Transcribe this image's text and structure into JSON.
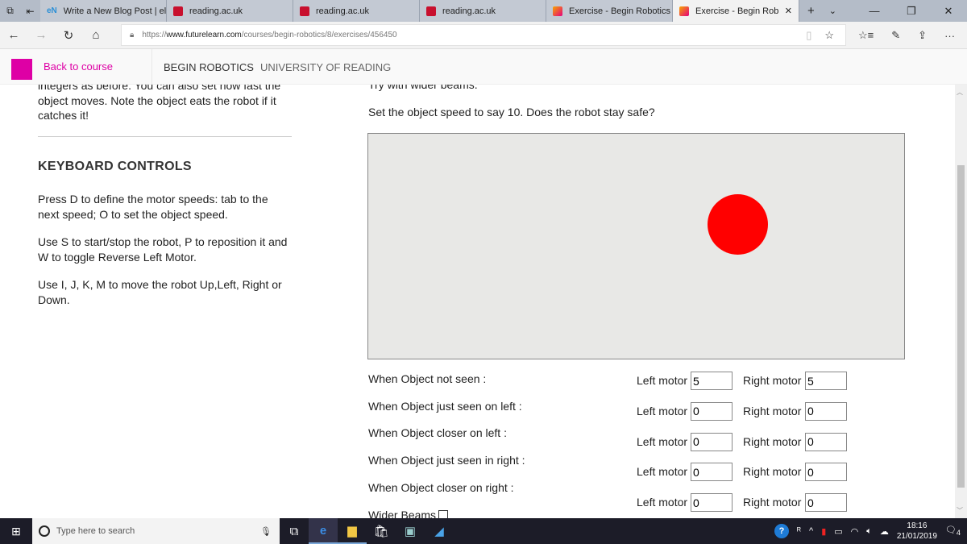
{
  "browser": {
    "tabs": [
      {
        "title": "Write a New Blog Post | eler",
        "icon": "elearning-favicon",
        "icon_text": "eN"
      },
      {
        "title": "reading.ac.uk",
        "icon": "uor-favicon"
      },
      {
        "title": "reading.ac.uk",
        "icon": "uor-favicon"
      },
      {
        "title": "reading.ac.uk",
        "icon": "uor-favicon"
      },
      {
        "title": "Exercise - Begin Robotics - U",
        "icon": "futurelearn-favicon"
      },
      {
        "title": "Exercise - Begin Robotic",
        "icon": "futurelearn-favicon",
        "active": true
      }
    ],
    "url_prefix": "https://",
    "url_domain": "www.futurelearn.com",
    "url_path": "/courses/begin-robotics/8/exercises/456450"
  },
  "site": {
    "back": "Back to course",
    "course": "BEGIN ROBOTICS",
    "university": "UNIVERSITY OF READING",
    "accent": "#de00a5"
  },
  "left": {
    "intro": "integers as before. You can also set how fast the object moves. Note the object eats the robot if it catches it!",
    "heading": "KEYBOARD CONTROLS",
    "p1": "Press D to define the motor speeds: tab to the next speed; O to set the object speed.",
    "p2": "Use S to start/stop the robot, P to reposition it and W to toggle Reverse Left Motor.",
    "p3": "Use I, J, K, M to move the robot Up,Left, Right or Down."
  },
  "right": {
    "clipped": "Try with wider beams.",
    "instruction": "Set the object speed to say 10. Does the robot stay safe?",
    "object_color": "#ff0000",
    "left_label": "Left motor",
    "right_label": "Right motor",
    "conditions": [
      {
        "label": "When Object not seen :",
        "left": "5",
        "right": "5"
      },
      {
        "label": "When Object just seen on left :",
        "left": "0",
        "right": "0"
      },
      {
        "label": "When Object closer on left :",
        "left": "0",
        "right": "0"
      },
      {
        "label": "When Object just seen in right :",
        "left": "0",
        "right": "0"
      },
      {
        "label": "When Object closer on right :",
        "left": "0",
        "right": "0"
      }
    ],
    "wider_beams": "Wider Beams"
  },
  "taskbar": {
    "search_placeholder": "Type here to search",
    "time": "18:16",
    "date": "21/01/2019",
    "notifications": "4"
  }
}
